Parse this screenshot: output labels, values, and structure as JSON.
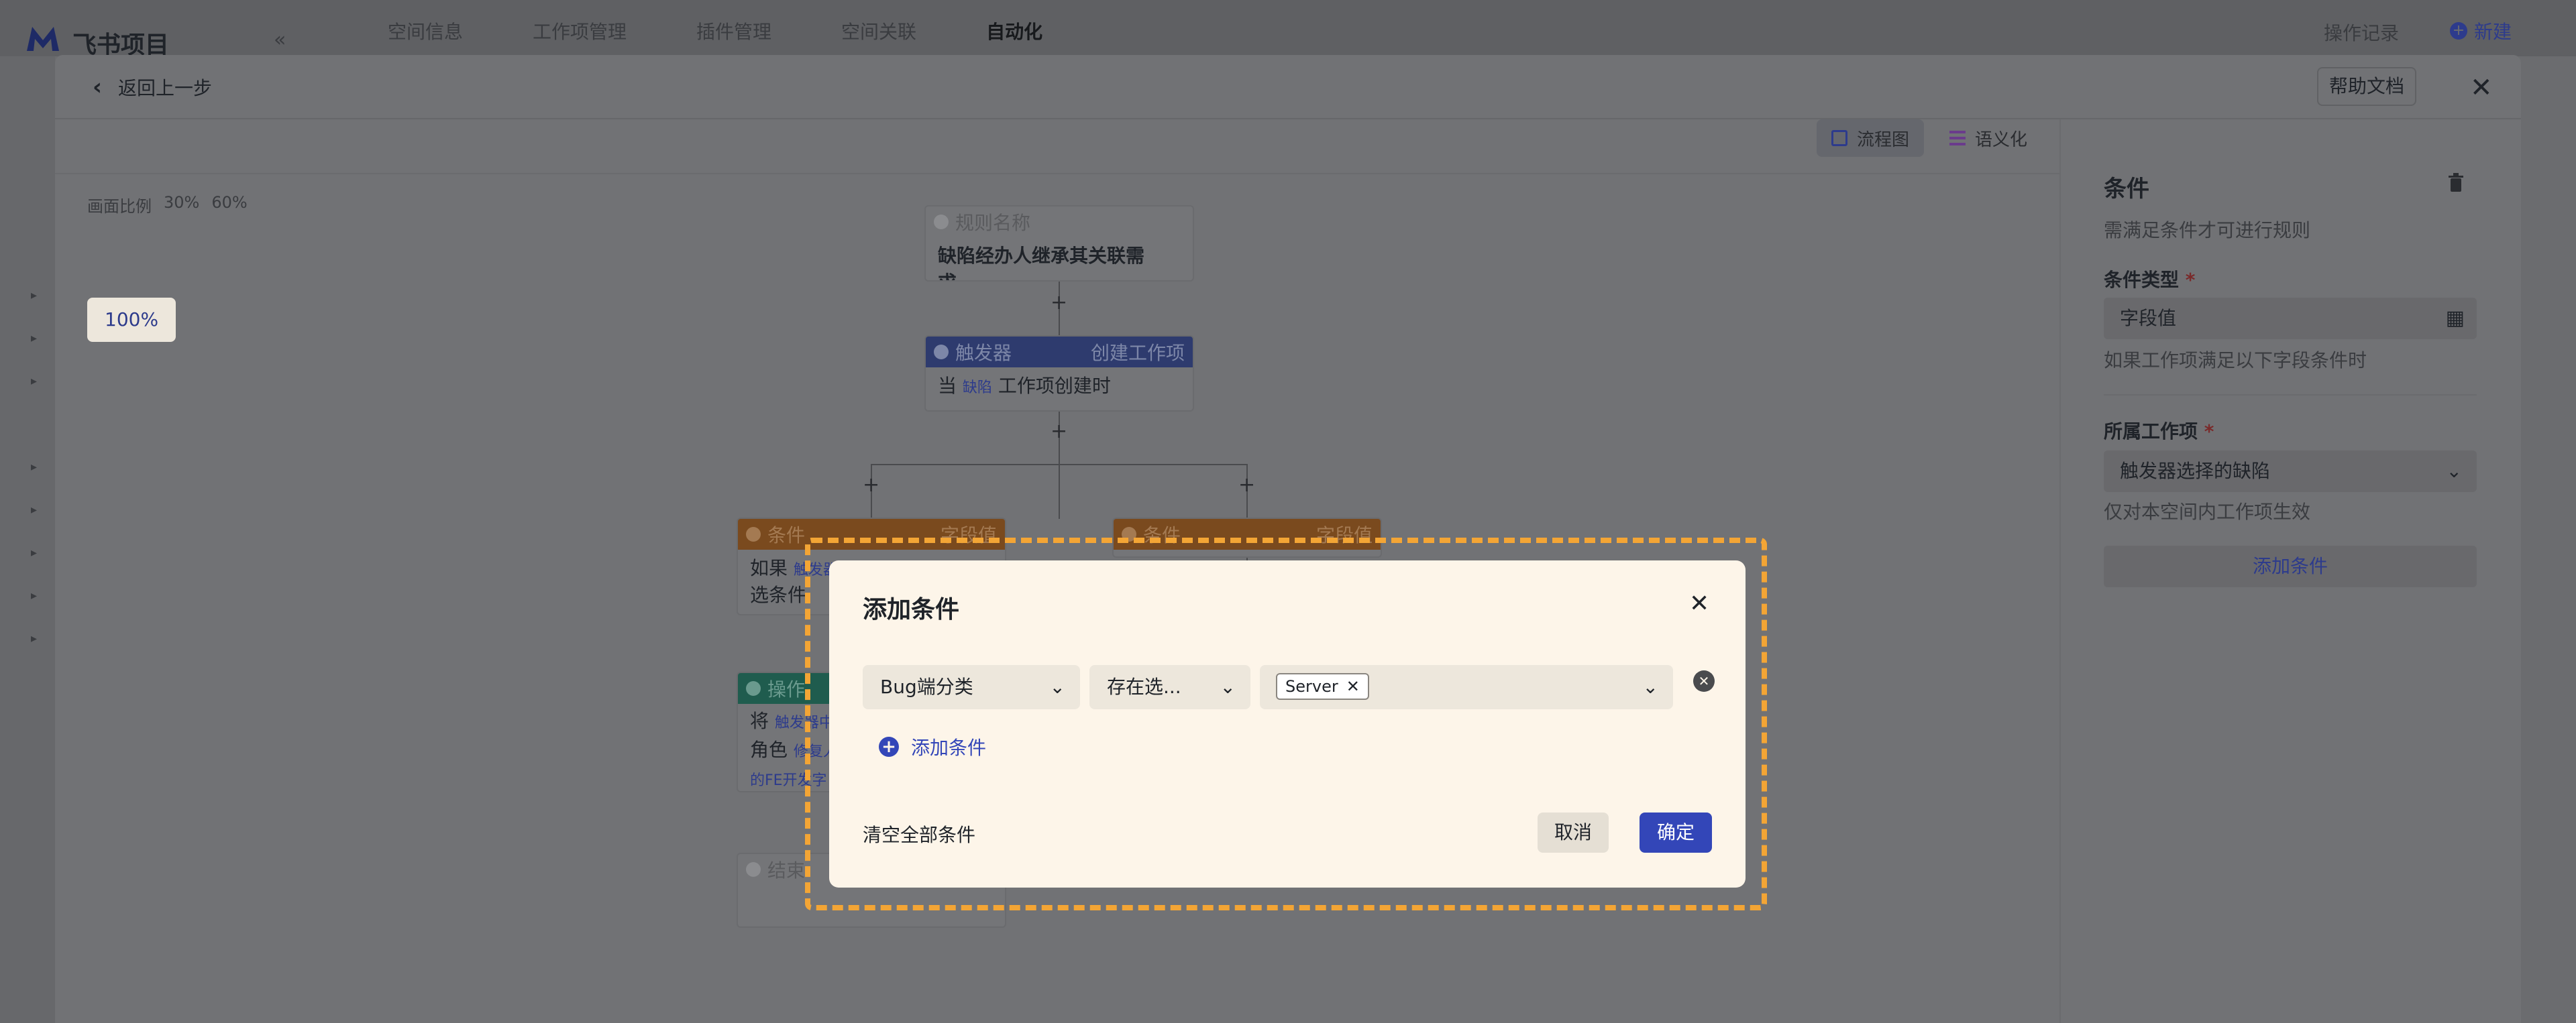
{
  "app": {
    "name": "飞书项目",
    "nav": [
      "空间信息",
      "工作项管理",
      "插件管理",
      "空间关联",
      "自动化"
    ],
    "nav_active": "自动化",
    "record": "操作记录",
    "new": "新建"
  },
  "panel": {
    "back": "返回上一步",
    "help": "帮助文档",
    "views": {
      "flow": "流程图",
      "semantic": "语义化"
    },
    "zoom": {
      "label": "画面比例",
      "options": [
        "30%",
        "60%",
        "100%"
      ],
      "selected": "100%"
    }
  },
  "flow": {
    "rule_head": "规则名称",
    "rule_body": "缺陷经办人继承其关联需求...",
    "trigger_head": "触发器",
    "trigger_tag": "创建工作项",
    "trigger_body_prefix": "当",
    "trigger_body_item": "缺陷",
    "trigger_body_suffix": "工作项创建时",
    "cond_head": "条件",
    "cond_tag": "字段值",
    "cond_left_line1": "如果",
    "cond_left_chip": "触发器",
    "cond_left_line2": "选条件",
    "action_head": "操作",
    "action_line1": "将",
    "action_chip": "触发器中",
    "action_line2": "角色",
    "action_chip2": "修复人",
    "action_line3": "的FE开发字",
    "end_head": "结束"
  },
  "config": {
    "title": "条件",
    "desc": "需满足条件才可进行规则",
    "type_label": "条件类型",
    "type_value": "字段值",
    "type_note": "如果工作项满足以下字段条件时",
    "item_label": "所属工作项",
    "item_value": "触发器选择的缺陷",
    "item_note": "仅对本空间内工作项生效",
    "add": "添加条件"
  },
  "dialog": {
    "title": "添加条件",
    "field": "Bug端分类",
    "operator": "存在选...",
    "value_chip": "Server",
    "add_condition": "添加条件",
    "clear_all": "清空全部条件",
    "cancel": "取消",
    "ok": "确定"
  },
  "colors": {
    "accent": "#3346b8",
    "highlight": "#f3a535",
    "dialog_bg": "#fdf5e9"
  }
}
